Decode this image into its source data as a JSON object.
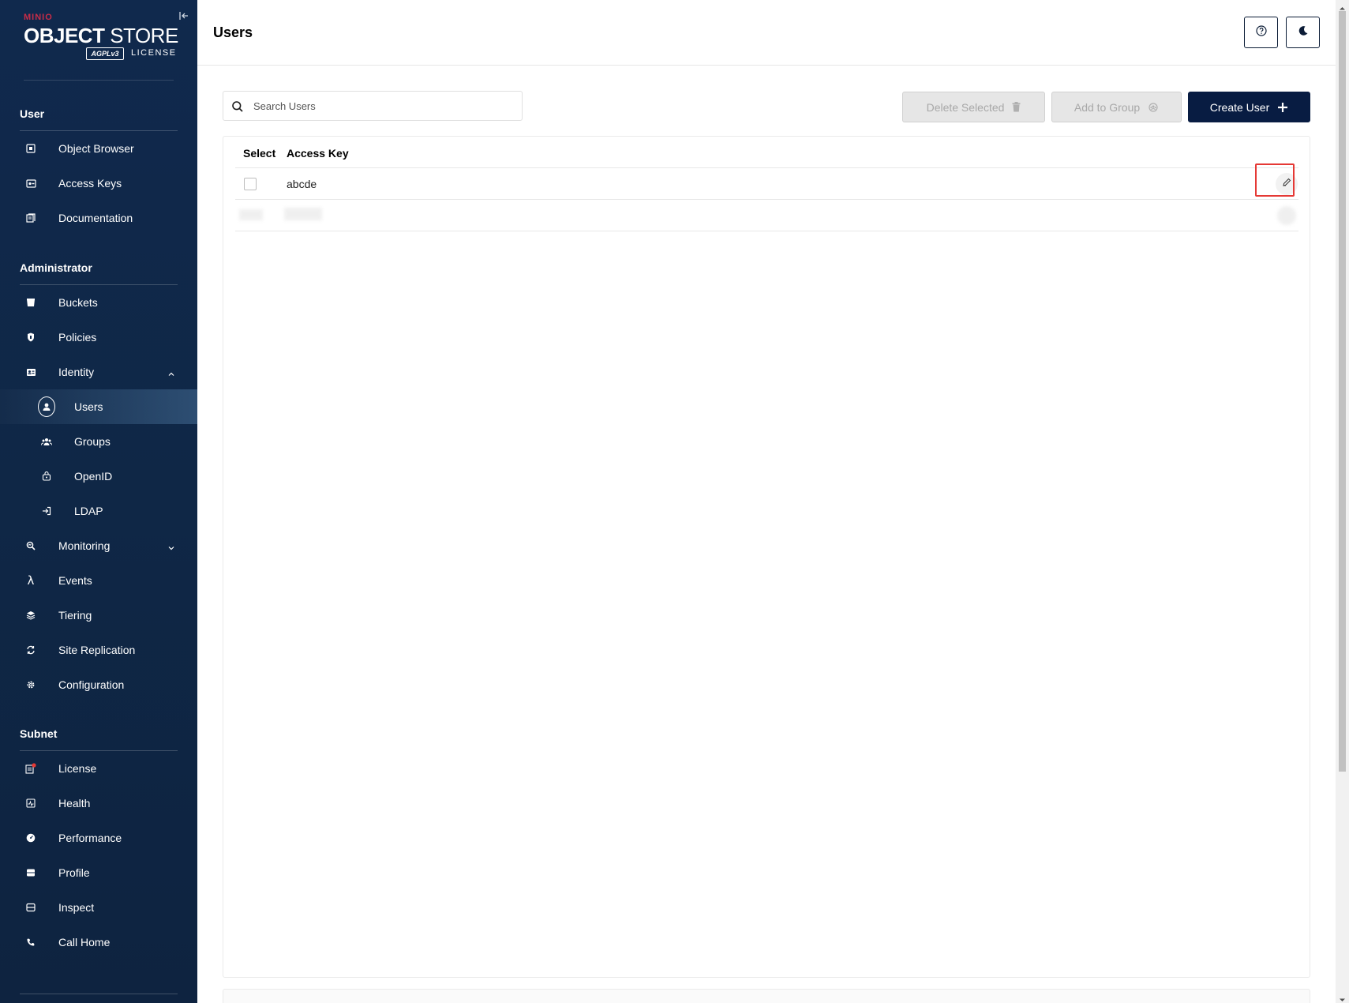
{
  "logo": {
    "brand": "MINIO",
    "product_bold": "OBJECT",
    "product_light": " STORE",
    "badge": "AGPLv3",
    "license": "LICENSE"
  },
  "sidebar": {
    "sections": [
      {
        "title": "User"
      },
      {
        "title": "Administrator"
      },
      {
        "title": "Subnet"
      }
    ],
    "user_items": [
      {
        "label": "Object Browser",
        "icon": "object-browser-icon"
      },
      {
        "label": "Access Keys",
        "icon": "access-keys-icon"
      },
      {
        "label": "Documentation",
        "icon": "documentation-icon"
      }
    ],
    "admin_items": [
      {
        "label": "Buckets",
        "icon": "buckets-icon"
      },
      {
        "label": "Policies",
        "icon": "policies-icon"
      },
      {
        "label": "Identity",
        "icon": "identity-icon",
        "expanded": true
      },
      {
        "label": "Users",
        "icon": "users-icon",
        "active": true
      },
      {
        "label": "Groups",
        "icon": "groups-icon"
      },
      {
        "label": "OpenID",
        "icon": "openid-icon"
      },
      {
        "label": "LDAP",
        "icon": "ldap-icon"
      },
      {
        "label": "Monitoring",
        "icon": "monitoring-icon",
        "expanded": false
      },
      {
        "label": "Events",
        "icon": "lambda-icon"
      },
      {
        "label": "Tiering",
        "icon": "tiering-icon"
      },
      {
        "label": "Site Replication",
        "icon": "site-replication-icon"
      },
      {
        "label": "Configuration",
        "icon": "gear-icon"
      }
    ],
    "subnet_items": [
      {
        "label": "License",
        "icon": "license-icon",
        "badge_color": "#e53935"
      },
      {
        "label": "Health",
        "icon": "health-icon"
      },
      {
        "label": "Performance",
        "icon": "performance-icon"
      },
      {
        "label": "Profile",
        "icon": "profile-icon"
      },
      {
        "label": "Inspect",
        "icon": "inspect-icon"
      },
      {
        "label": "Call Home",
        "icon": "phone-icon"
      }
    ]
  },
  "header": {
    "title": "Users",
    "help_icon": "help-icon",
    "theme_icon": "moon-icon"
  },
  "toolbar": {
    "search_placeholder": "Search Users",
    "delete_label": "Delete Selected",
    "add_group_label": "Add to Group",
    "create_label": "Create User"
  },
  "table": {
    "columns": [
      "Select",
      "Access Key"
    ],
    "rows": [
      {
        "access_key": "abcde",
        "selected": false
      }
    ]
  },
  "colors": {
    "sidebar_bg": "#0f2746",
    "primary": "#081c42",
    "highlight": "#e53935"
  }
}
